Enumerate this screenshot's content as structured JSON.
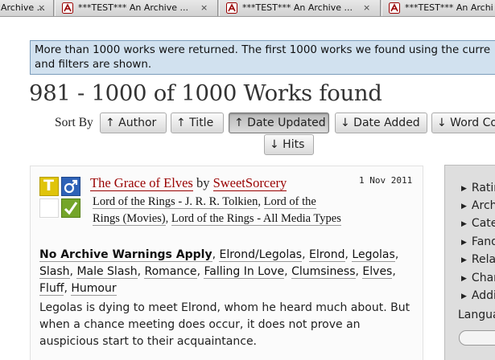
{
  "tabs": [
    {
      "title": "Archive ...",
      "close": "×"
    },
    {
      "title": "***TEST*** An Archive ...",
      "close": "×"
    },
    {
      "title": "***TEST*** An Archive ...",
      "close": "×"
    },
    {
      "title": "***TEST*** An Archi"
    }
  ],
  "notice": {
    "line1": "More than 1000 works were returned. The first 1000 works we found using the curre",
    "line2": "and filters are shown."
  },
  "heading": "981 - 1000 of 1000 Works found",
  "sort": {
    "label": "Sort By",
    "buttons": [
      "↑ Author",
      "↑ Title",
      "↑ Date Updated",
      "↓ Date Added",
      "↓ Word Co",
      "↓ Hits"
    ],
    "active": "↑ Date Updated"
  },
  "work": {
    "rating_symbol": "T",
    "category_symbol": "♂",
    "complete_symbol": "✓",
    "title": "The Grace of Elves",
    "by": "by",
    "author": "SweetSorcery",
    "date": "1 Nov 2011",
    "fandoms": [
      "Lord of the Rings - J. R. R. Tolkien",
      "Lord of the Rings (Movies)",
      "Lord of the Rings - All Media Types"
    ],
    "fandom_line1a": "Lord of the Rings - J. R. R. Tolkien",
    "fandom_line1b": "Lord of the",
    "fandom_line2a": "Rings (Movies)",
    "fandom_line2b": "Lord of the Rings - All Media Types",
    "warning": "No Archive Warnings Apply",
    "tags": [
      "Elrond/Legolas",
      "Elrond",
      "Legolas",
      "Slash",
      "Male Slash",
      "Romance",
      "Falling In Love",
      "Clumsiness",
      "Elves",
      "Fluff",
      "Humour"
    ],
    "summary": "Legolas is dying to meet Elrond, whom he heard much about. But when a chance meeting does occur, it does not prove an auspicious start to their acquaintance."
  },
  "sidebar": {
    "items": [
      "Ratin",
      "Arch",
      "Cate",
      "Fand",
      "Rela",
      "Char",
      "Addi"
    ],
    "language": "Langua"
  },
  "colors": {
    "title_link": "#990000",
    "rating": "#e0c40a",
    "category": "#2e62b7",
    "complete": "#74a529",
    "notice_bg": "#d1e1ef"
  }
}
